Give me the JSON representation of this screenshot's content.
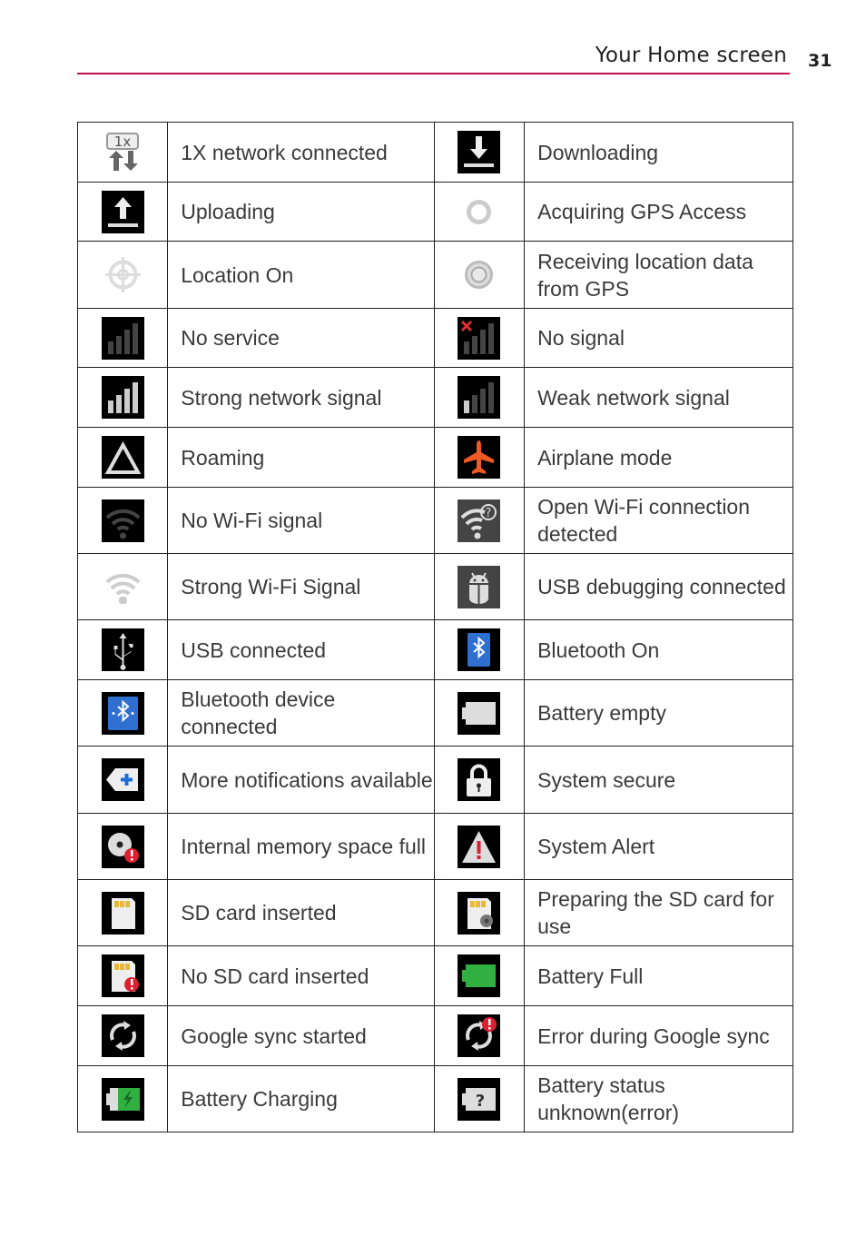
{
  "header": {
    "title": "Your Home screen",
    "page_number": "31",
    "accent_color": "#c3124e"
  },
  "table": {
    "rows": [
      [
        {
          "icon": "1x-network-icon",
          "label": "1X network connected"
        },
        {
          "icon": "download-icon",
          "label": "Downloading"
        }
      ],
      [
        {
          "icon": "upload-icon",
          "label": "Uploading"
        },
        {
          "icon": "gps-acquiring-icon",
          "label": "Acquiring GPS Access"
        }
      ],
      [
        {
          "icon": "location-on-icon",
          "label": "Location On"
        },
        {
          "icon": "gps-receiving-icon",
          "label": "Receiving location data from GPS"
        }
      ],
      [
        {
          "icon": "no-service-icon",
          "label": "No service"
        },
        {
          "icon": "no-signal-icon",
          "label": "No signal"
        }
      ],
      [
        {
          "icon": "strong-signal-icon",
          "label": "Strong network signal"
        },
        {
          "icon": "weak-signal-icon",
          "label": "Weak network signal"
        }
      ],
      [
        {
          "icon": "roaming-icon",
          "label": "Roaming"
        },
        {
          "icon": "airplane-icon",
          "label": "Airplane mode"
        }
      ],
      [
        {
          "icon": "wifi-none-icon",
          "label": "No Wi-Fi signal"
        },
        {
          "icon": "wifi-open-icon",
          "label": "Open Wi-Fi connection detected"
        }
      ],
      [
        {
          "icon": "wifi-strong-icon",
          "label": "Strong Wi-Fi Signal"
        },
        {
          "icon": "usb-debug-icon",
          "label": "USB debugging connected"
        }
      ],
      [
        {
          "icon": "usb-icon",
          "label": "USB connected"
        },
        {
          "icon": "bluetooth-on-icon",
          "label": "Bluetooth On"
        }
      ],
      [
        {
          "icon": "bluetooth-connected-icon",
          "label": "Bluetooth device connected"
        },
        {
          "icon": "battery-empty-icon",
          "label": "Battery empty"
        }
      ],
      [
        {
          "icon": "more-notifications-icon",
          "label": "More notifications available"
        },
        {
          "icon": "lock-icon",
          "label": "System secure"
        }
      ],
      [
        {
          "icon": "memory-full-icon",
          "label": "Internal memory space full"
        },
        {
          "icon": "alert-icon",
          "label": "System Alert"
        }
      ],
      [
        {
          "icon": "sd-card-icon",
          "label": "SD card inserted"
        },
        {
          "icon": "sd-preparing-icon",
          "label": "Preparing the SD card for use"
        }
      ],
      [
        {
          "icon": "no-sd-card-icon",
          "label": "No SD card inserted"
        },
        {
          "icon": "battery-full-icon",
          "label": "Battery Full"
        }
      ],
      [
        {
          "icon": "sync-icon",
          "label": "Google sync started"
        },
        {
          "icon": "sync-error-icon",
          "label": "Error during Google sync"
        }
      ],
      [
        {
          "icon": "battery-charging-icon",
          "label": "Battery Charging"
        },
        {
          "icon": "battery-unknown-icon",
          "label": "Battery status unknown(error)"
        }
      ]
    ]
  }
}
